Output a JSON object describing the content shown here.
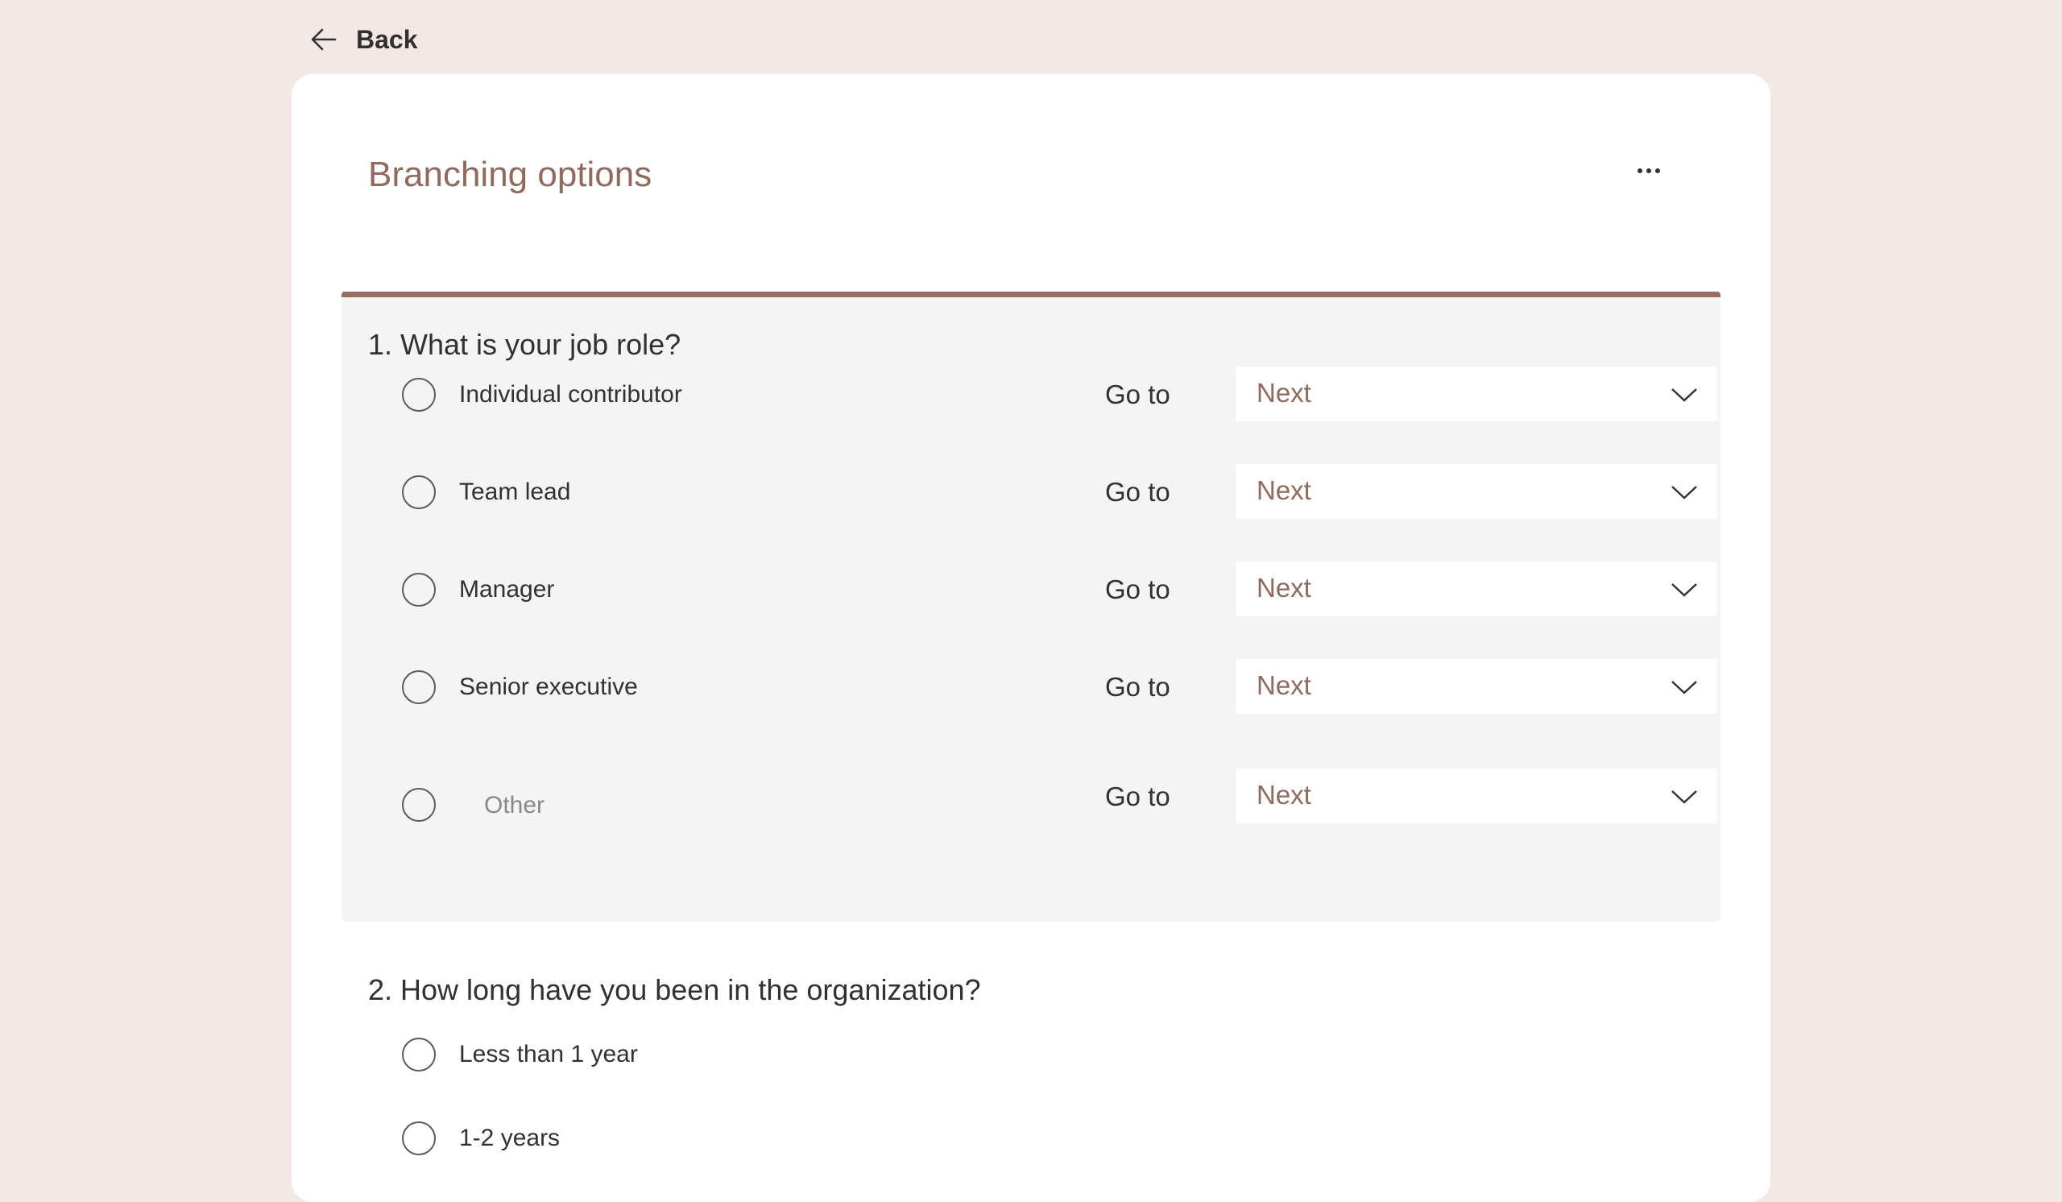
{
  "nav": {
    "back_label": "Back"
  },
  "form": {
    "title": "Branching options"
  },
  "question1": {
    "title": "1. What is your job role?",
    "goto_label": "Go to",
    "options": [
      {
        "label": "Individual contributor",
        "goto_value": "Next"
      },
      {
        "label": "Team lead",
        "goto_value": "Next"
      },
      {
        "label": "Manager",
        "goto_value": "Next"
      },
      {
        "label": "Senior executive",
        "goto_value": "Next"
      },
      {
        "label": "Other",
        "goto_value": "Next"
      }
    ]
  },
  "question2": {
    "title": "2. How long have you been in the organization?",
    "options": [
      {
        "label": "Less than 1 year"
      },
      {
        "label": "1-2 years"
      }
    ]
  },
  "colors": {
    "accent": "#9a6c62",
    "title": "#8e6b5e",
    "background": "#f2e8e6"
  }
}
